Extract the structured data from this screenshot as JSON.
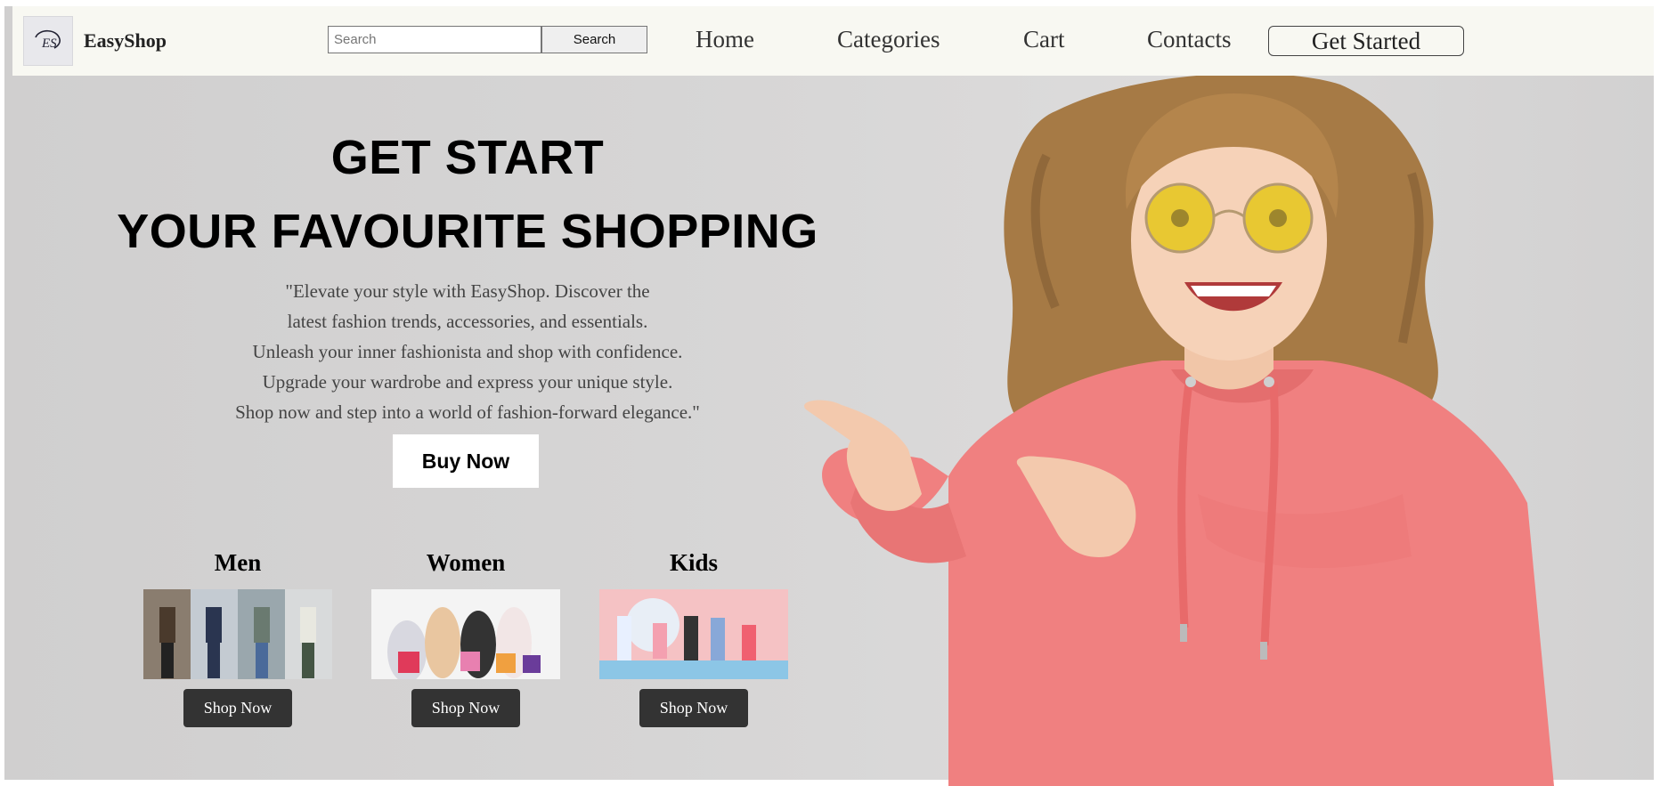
{
  "nav": {
    "brand": "EasyShop",
    "logo_text": "ES",
    "search_placeholder": "Search",
    "search_button": "Search",
    "links": [
      "Home",
      "Categories",
      "Cart",
      "Contacts"
    ],
    "cta": "Get Started"
  },
  "hero": {
    "title_line1": "GET START",
    "title_line2": "YOUR FAVOURITE SHOPPING",
    "tagline": [
      "\"Elevate your style with EasyShop. Discover the",
      "latest fashion trends, accessories, and essentials.",
      "Unleash your inner fashionista and shop with confidence.",
      "Upgrade your wardrobe and express your unique style.",
      "Shop now and step into a world of fashion-forward elegance.\""
    ],
    "buy_button": "Buy Now"
  },
  "categories": [
    {
      "name": "Men",
      "button": "Shop Now"
    },
    {
      "name": "Women",
      "button": "Shop Now"
    },
    {
      "name": "Kids",
      "button": "Shop Now"
    }
  ],
  "colors": {
    "navbar_bg": "#f8f8f2",
    "hero_bg": "#d4d3d3",
    "shop_button_bg": "#333333",
    "hoodie": "#f08080",
    "glasses": "#e8c832"
  }
}
